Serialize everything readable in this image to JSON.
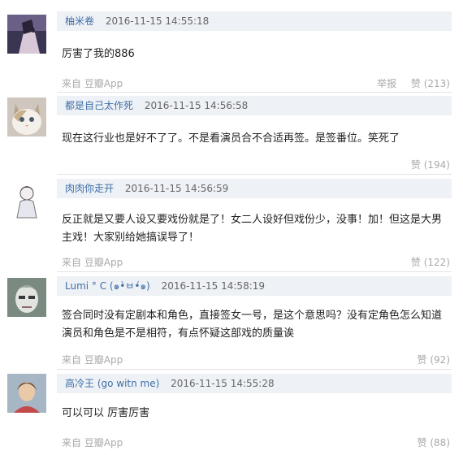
{
  "comments": [
    {
      "author": "柚米卷",
      "time": "2016-11-15 14:55:18",
      "text": "厉害了我的886",
      "source": "来自 豆瓣App",
      "report": "举报",
      "likes": "赞 (213)",
      "avatar_icon": "anime-character-avatar"
    },
    {
      "author": "都是自己太作死",
      "time": "2016-11-15 14:56:58",
      "text": "现在这行业也是好不了了。不是看演员合不合适再签。是签番位。笑死了",
      "source": "",
      "report": "",
      "likes": "赞 (194)",
      "avatar_icon": "cat-photo-avatar"
    },
    {
      "author": "肉肉你走开",
      "time": "2016-11-15 14:56:59",
      "text": "反正就是又要人设又要戏份就是了！女二人设好但戏份少，没事！加！但这是大男主戏！大家别给她搞误导了！",
      "source": "来自 豆瓣App",
      "report": "",
      "likes": "赞 (122)",
      "avatar_icon": "sketch-girl-avatar"
    },
    {
      "author": "Lumi ° C (๑•̀ㅂ•́๑)",
      "time": "2016-11-15 14:58:19",
      "text": "签合同时没有定剧本和角色，直接签女一号，是这个意思吗？没有定角色怎么知道演员和角色是不是相符，有点怀疑这部戏的质量诶",
      "source": "来自 豆瓣App",
      "report": "",
      "likes": "赞 (92)",
      "avatar_icon": "face-photo-avatar"
    },
    {
      "author": "高冷王 (go witn me)",
      "time": "2016-11-15 14:55:28",
      "text": "可以可以 厉害厉害",
      "source": "来自 豆瓣App",
      "report": "",
      "likes": "赞 (88)",
      "avatar_icon": "person-photo-avatar"
    }
  ],
  "colors": {
    "author_link": "#3f6fa8",
    "header_bg": "#eef1f5",
    "meta_gray": "#aaaaaa"
  }
}
